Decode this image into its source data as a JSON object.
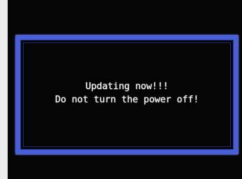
{
  "dialog": {
    "line1": "Updating now!!!",
    "line2": "Do not turn the power off!"
  },
  "colors": {
    "screen_background": "#060606",
    "frame_border": "#4a5fd6",
    "text": "#f2f2f2",
    "page_background": "#ececec"
  }
}
